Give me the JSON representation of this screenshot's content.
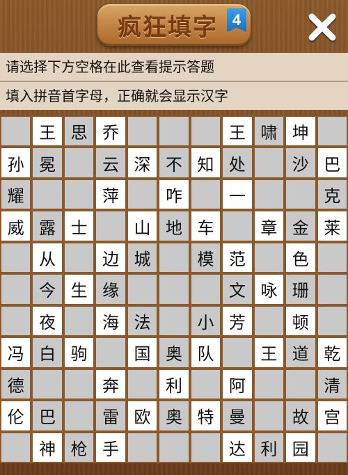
{
  "header": {
    "title": "疯狂填字",
    "level": "4"
  },
  "hints": {
    "line1": "请选择下方空格在此查看提示答题",
    "line2": "填入拼音首字母，正确就会显示汉字"
  },
  "colors": {
    "grid_gray": "#c9c9c9",
    "grid_white": "#ffffff",
    "wood": "#7b4a22",
    "hint_bg": "#e4d4c2",
    "title_text": "#7a3b10",
    "badge": "#1b6fc0"
  },
  "grid": {
    "rows": [
      [
        "",
        "王",
        "思",
        "乔",
        "",
        "",
        "",
        "王",
        "啸",
        "坤",
        ""
      ],
      [
        "孙",
        "冕",
        "",
        "云",
        "深",
        "不",
        "知",
        "处",
        "",
        "沙",
        "巴"
      ],
      [
        "耀",
        "",
        "",
        "萍",
        "",
        "咋",
        "",
        "一",
        "",
        "",
        "克"
      ],
      [
        "威",
        "露",
        "士",
        "",
        "山",
        "地",
        "车",
        "",
        "章",
        "金",
        "莱"
      ],
      [
        "",
        "从",
        "",
        "边",
        "城",
        "",
        "模",
        "范",
        "",
        "色",
        ""
      ],
      [
        "",
        "今",
        "生",
        "缘",
        "",
        "",
        "",
        "文",
        "咏",
        "珊",
        ""
      ],
      [
        "",
        "夜",
        "",
        "海",
        "法",
        "",
        "小",
        "芳",
        "",
        "顿",
        ""
      ],
      [
        "冯",
        "白",
        "驹",
        "",
        "国",
        "奥",
        "队",
        "",
        "王",
        "道",
        "乾"
      ],
      [
        "德",
        "",
        "",
        "奔",
        "",
        "利",
        "",
        "阿",
        "",
        "",
        "清"
      ],
      [
        "伦",
        "巴",
        "",
        "雷",
        "欧",
        "奥",
        "特",
        "曼",
        "",
        "故",
        "宫"
      ],
      [
        "",
        "神",
        "枪",
        "手",
        "",
        "",
        "",
        "达",
        "利",
        "园",
        ""
      ]
    ]
  }
}
